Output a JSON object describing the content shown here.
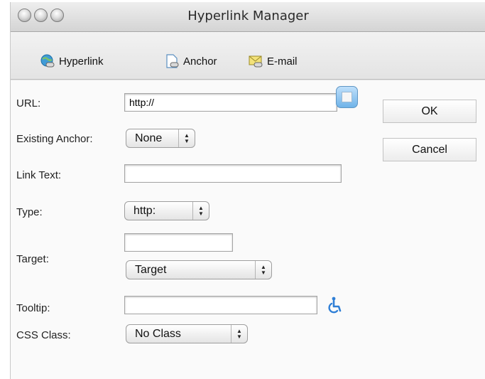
{
  "window": {
    "title": "Hyperlink Manager"
  },
  "tabs": [
    {
      "label": "Hyperlink",
      "icon": "globe-link-icon"
    },
    {
      "label": "Anchor",
      "icon": "anchor-link-icon"
    },
    {
      "label": "E-mail",
      "icon": "mail-link-icon"
    }
  ],
  "form": {
    "url": {
      "label": "URL:",
      "value": "http://"
    },
    "existing_anchor": {
      "label": "Existing Anchor:",
      "selected": "None"
    },
    "link_text": {
      "label": "Link Text:",
      "value": ""
    },
    "type": {
      "label": "Type:",
      "selected": "http:"
    },
    "target": {
      "label": "Target:",
      "value": "",
      "selected": "Target"
    },
    "tooltip": {
      "label": "Tooltip:",
      "value": ""
    },
    "css_class": {
      "label": "CSS Class:",
      "selected": "No Class"
    }
  },
  "buttons": {
    "ok": "OK",
    "cancel": "Cancel"
  },
  "icons": {
    "browse": "browse-file-icon",
    "accessibility": "accessibility-icon"
  },
  "colors": {
    "accent": "#5aa6e6",
    "accessibility": "#2f7fd6"
  }
}
